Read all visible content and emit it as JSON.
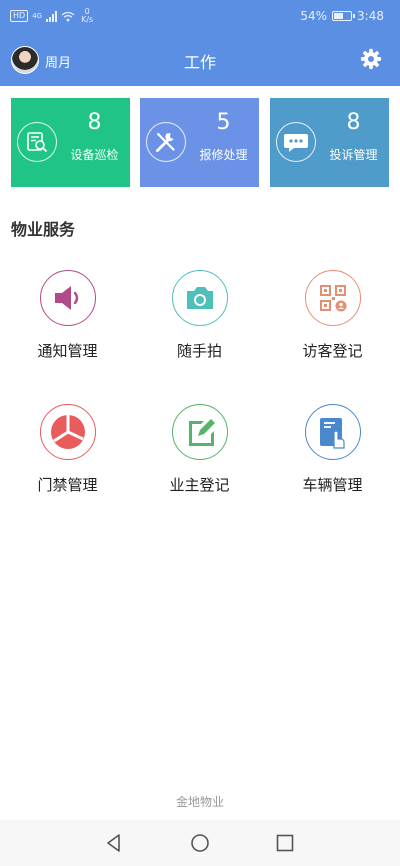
{
  "status_bar": {
    "hd": "HD",
    "network": "4G",
    "speed_value": "0",
    "speed_unit": "K/s",
    "battery_percent": "54%",
    "battery_level": 0.54,
    "time": "3:48"
  },
  "header": {
    "user_name": "周月",
    "title": "工作",
    "settings_icon": "gear-icon"
  },
  "cards": [
    {
      "count": "8",
      "label": "设备巡检",
      "color": "#1fc486",
      "icon": "inspection-icon"
    },
    {
      "count": "5",
      "label": "报修处理",
      "color": "#6b92e6",
      "icon": "repair-tools-icon"
    },
    {
      "count": "8",
      "label": "投诉管理",
      "color": "#4f9bc9",
      "icon": "chat-bubble-icon"
    }
  ],
  "section_title": "物业服务",
  "services": [
    {
      "label": "通知管理",
      "icon": "speaker-icon",
      "ring_color": "#b04a88"
    },
    {
      "label": "随手拍",
      "icon": "camera-icon",
      "ring_color": "#4fbfba"
    },
    {
      "label": "访客登记",
      "icon": "qr-code-icon",
      "ring_color": "#e58f72"
    },
    {
      "label": "门禁管理",
      "icon": "pie-chart-icon",
      "ring_color": "#e95c5c"
    },
    {
      "label": "业主登记",
      "icon": "edit-icon",
      "ring_color": "#56b46a"
    },
    {
      "label": "车辆管理",
      "icon": "tap-document-icon",
      "ring_color": "#4a87cc"
    }
  ],
  "footer_brand": "金地物业"
}
